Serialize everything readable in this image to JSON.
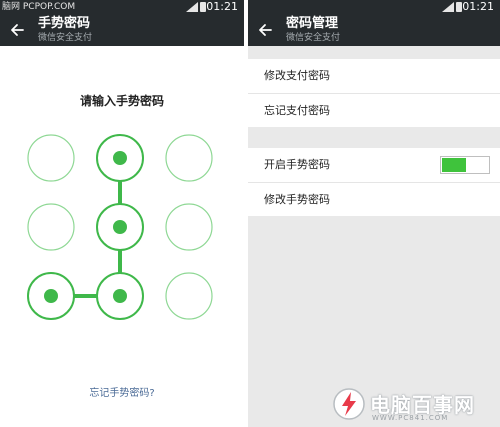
{
  "left_screen": {
    "status": {
      "source_text": "脑网 PCPOP.COM",
      "time": "01:21"
    },
    "appbar": {
      "title": "手势密码",
      "subtitle": "微信安全支付"
    },
    "prompt": "请输入手势密码",
    "pattern": {
      "grid_size": 3,
      "selected_nodes": [
        1,
        4,
        7,
        6
      ],
      "accent_color": "#3fb84a",
      "ring_color": "#8fd895"
    },
    "forgot_link": "忘记手势密码?"
  },
  "right_screen": {
    "status": {
      "time": "01:21"
    },
    "appbar": {
      "title": "密码管理",
      "subtitle": "微信安全支付"
    },
    "payment_section": [
      {
        "label": "修改支付密码"
      },
      {
        "label": "忘记支付密码"
      }
    ],
    "gesture_section": {
      "enable_label": "开启手势密码",
      "enable_on": true,
      "modify_label": "修改手势密码"
    }
  },
  "watermark": {
    "name": "电脑百事网",
    "url": "WWW.PC841.COM"
  }
}
